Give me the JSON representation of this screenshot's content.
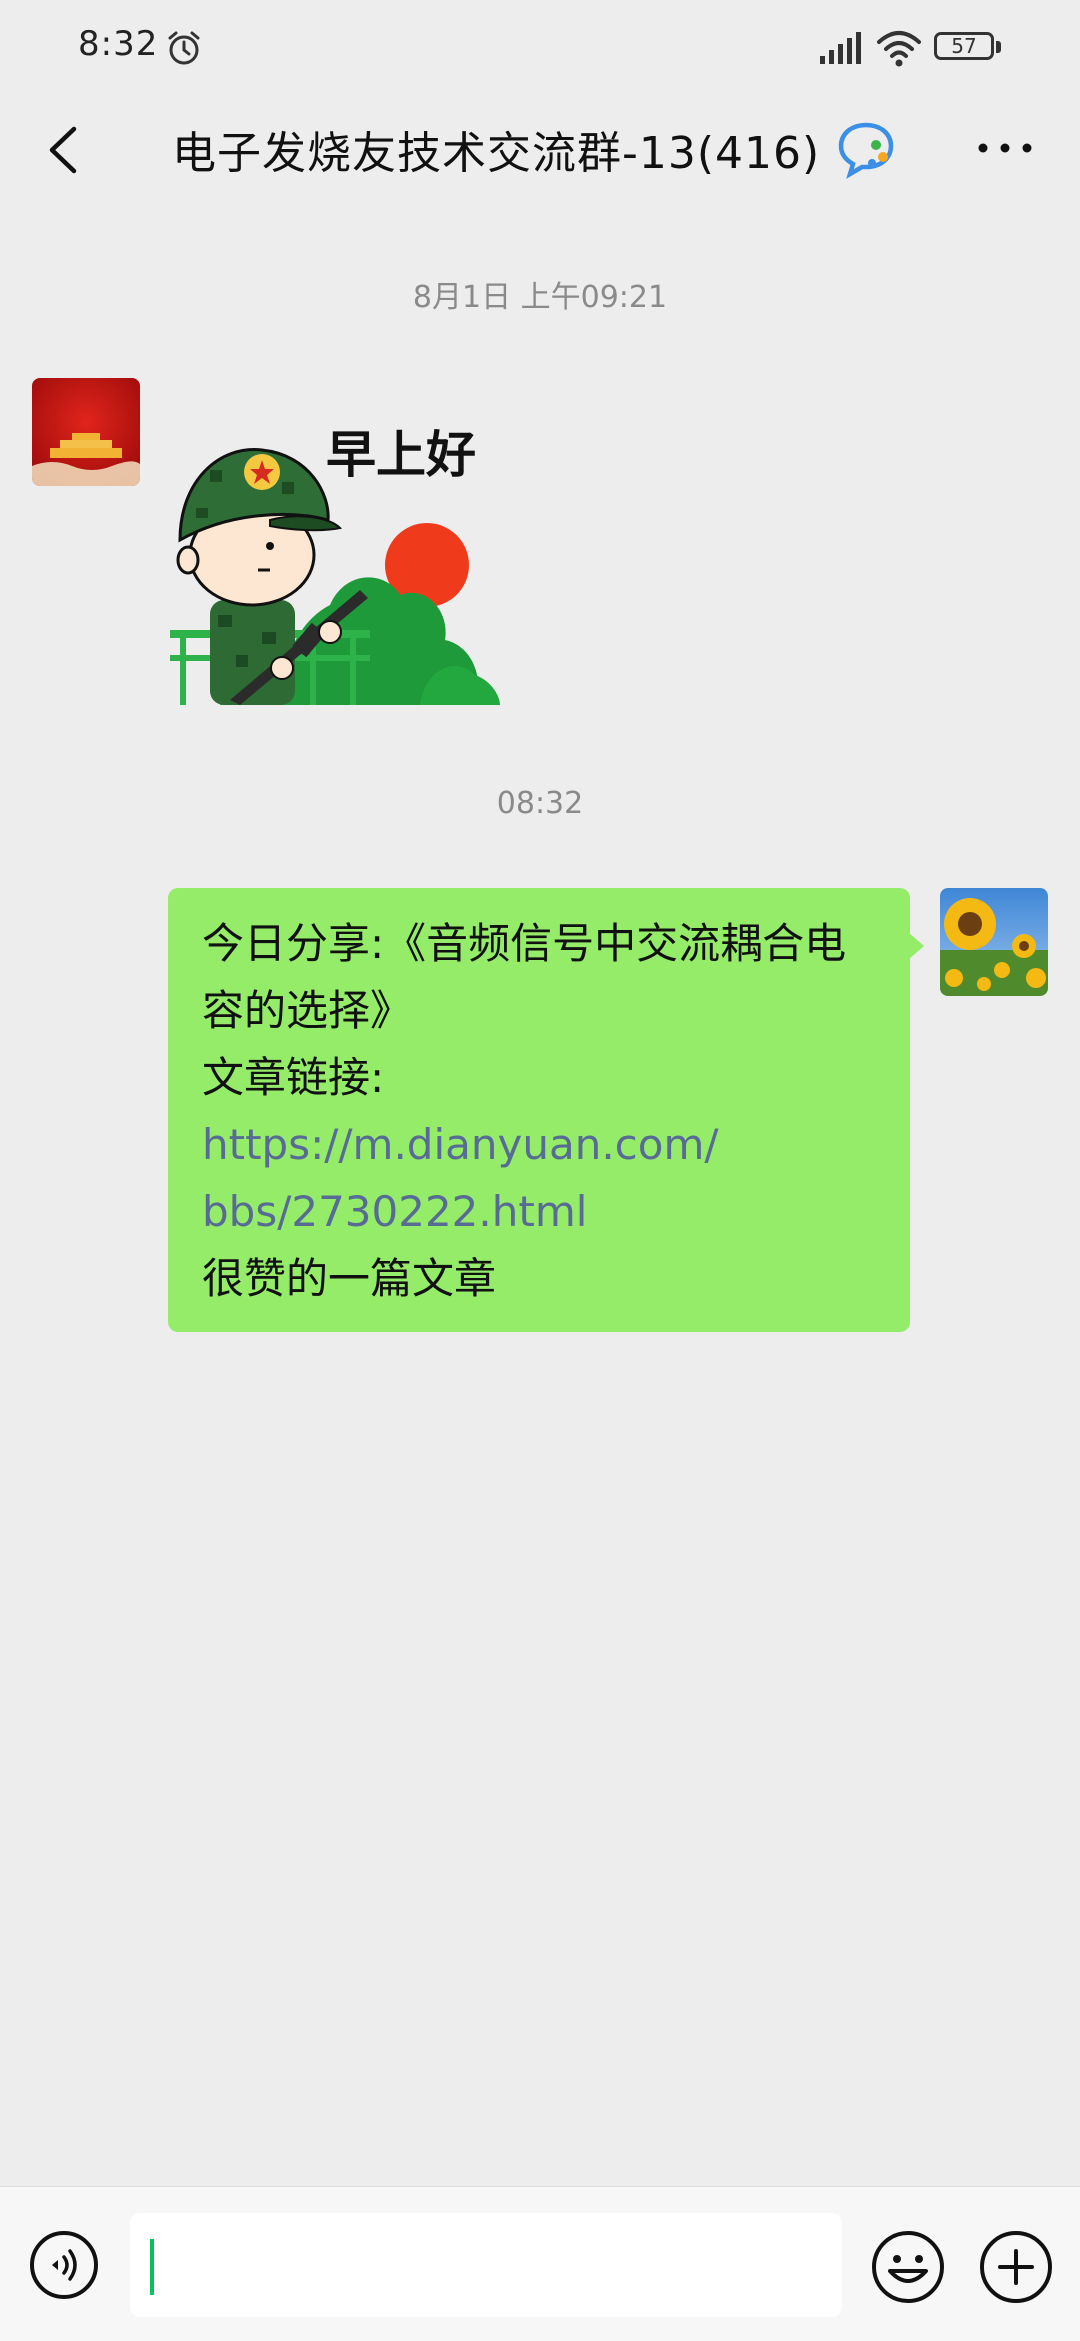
{
  "status_bar": {
    "time": "8:32",
    "battery": "57",
    "icons": [
      "alarm-icon",
      "signal-icon",
      "wifi-icon",
      "battery-icon"
    ]
  },
  "header": {
    "title": "电子发烧友技术交流群-13(416)",
    "icons": [
      "back-arrow-icon",
      "chat-bubble-icon",
      "more-dots-icon"
    ]
  },
  "messages": [
    {
      "timestamp": "8月1日 上午09:21",
      "sender": "left",
      "type": "sticker",
      "sticker_text": "早上好"
    },
    {
      "timestamp": "08:32",
      "sender": "right",
      "type": "text",
      "lines": [
        "今日分享:《音频信号中交流耦合电",
        "容的选择》",
        "文章链接:",
        "https://m.dianyuan.com/",
        "bbs/2730222.html",
        "很赞的一篇文章"
      ]
    }
  ],
  "input_bar": {
    "value": "",
    "icons": [
      "voice-icon",
      "emoji-icon",
      "plus-icon"
    ]
  },
  "colors": {
    "background": "#ededed",
    "bubble_green": "#95ec69",
    "link": "#576b95",
    "cursor": "#07c160"
  }
}
